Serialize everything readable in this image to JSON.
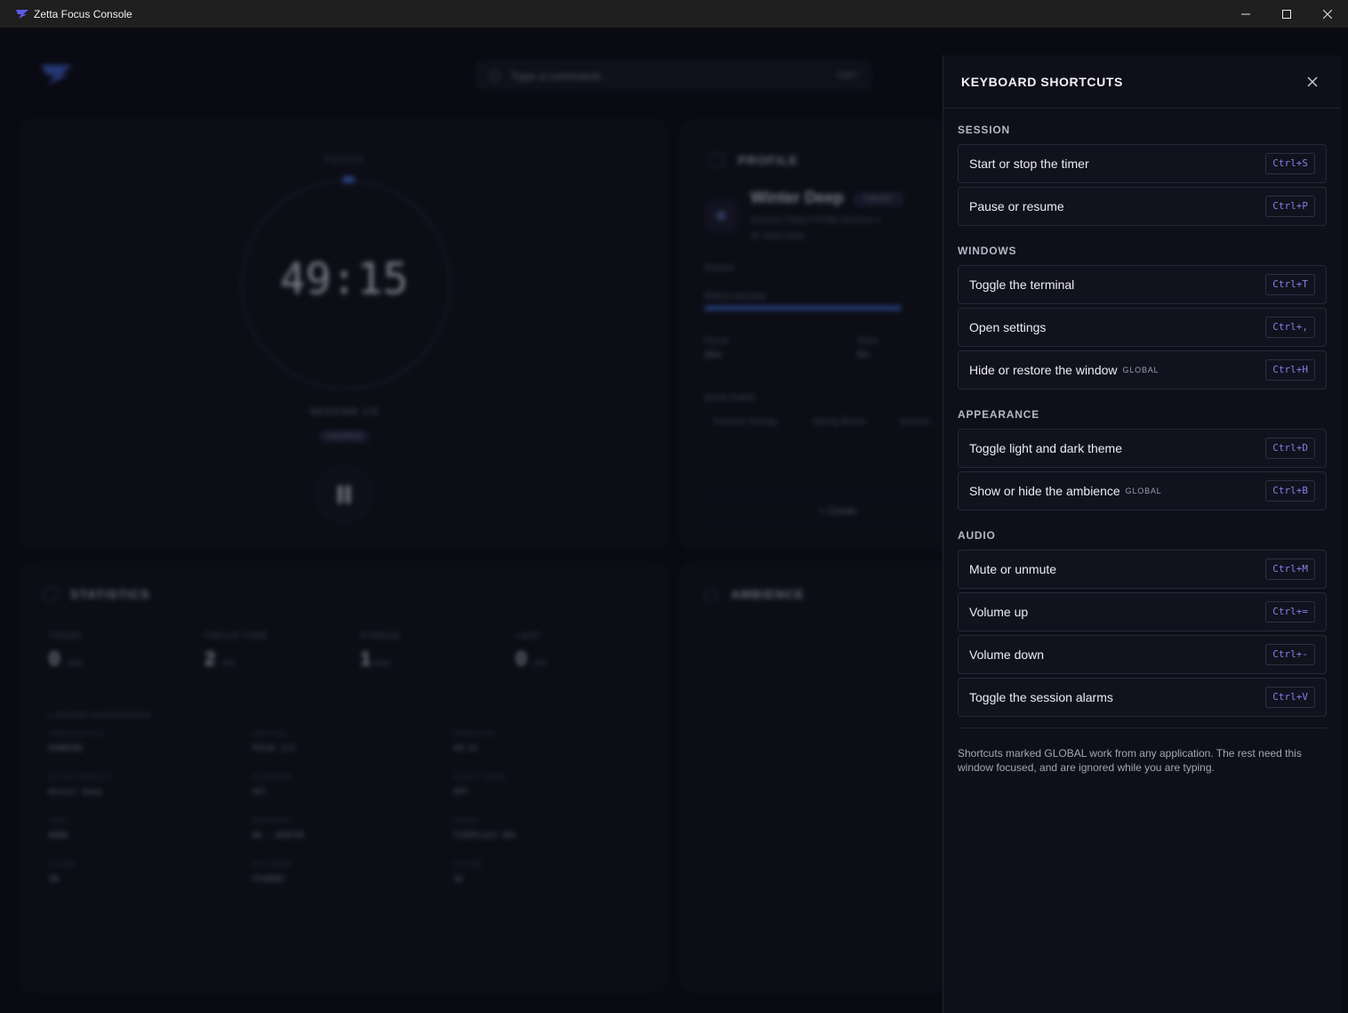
{
  "window": {
    "title": "Zetta Focus Console",
    "controls": {
      "minimize": "—",
      "maximize": "☐",
      "close": "✕"
    }
  },
  "background": {
    "command_placeholder": "Type a command...",
    "command_shortcut": "Ctrl  I",
    "timer": {
      "focus_label": "FOCUS",
      "time": "49:15",
      "session_label": "SESSION 1/3",
      "override_badge": "OVERRIDE"
    },
    "profile": {
      "title": "PROFILE",
      "name": "Winter Deep",
      "badge": "PRESET",
      "meta": "Sessions Today  0    Profile Sessions  4",
      "id": "ID: winter-deep",
      "season_label": "Season",
      "motion_label": "Motion Intensity",
      "focus_label": "Focus",
      "focus_value": "25m",
      "short_label": "Short",
      "short_value": "5m",
      "quick_switch_label": "Quick Switch",
      "chips": [
        "Summer Energy",
        "Spring Bloom",
        "Autumn"
      ],
      "create_label": "+  Create"
    },
    "statistics": {
      "title": "STATISTICS",
      "stats": [
        {
          "label": "TODAY",
          "value": "0",
          "unit": "sess"
        },
        {
          "label": "FOCUS TIME",
          "value": "2",
          "unit": "min"
        },
        {
          "label": "STREAK",
          "value": "1",
          "unit": "days"
        },
        {
          "label": "LAST",
          "value": "0",
          "unit": "min"
        }
      ],
      "diagnostics_title": "▸ ENGINE DIAGNOSTICS",
      "diagnostics": [
        {
          "label": "TIMER STATUS",
          "value": "RUNNING"
        },
        {
          "label": "SESSION",
          "value": "FOCUS 1/3"
        },
        {
          "label": "REMAINING",
          "value": "49:15"
        },
        {
          "label": "ACTIVE PROFILE",
          "value": "Winter Deep"
        },
        {
          "label": "OVERRIDE",
          "value": "SET"
        },
        {
          "label": "STRICT MODE",
          "value": "OFF"
        },
        {
          "label": "TASK",
          "value": "NONE"
        },
        {
          "label": "AMBIENCE",
          "value": "ON · WINTER"
        },
        {
          "label": "SOUND",
          "value": "FIREPLACE 50%"
        },
        {
          "label": "ALARM",
          "value": "ON"
        },
        {
          "label": "DEV MODE",
          "value": "STANDBY"
        },
        {
          "label": "UPTIME",
          "value": "3m"
        }
      ]
    },
    "ambience": {
      "title": "AMBIENCE"
    }
  },
  "shortcuts": {
    "title": "KEYBOARD SHORTCUTS",
    "close_icon": "✕",
    "global_tag": "GLOBAL",
    "sections": [
      {
        "title": "SESSION",
        "items": [
          {
            "label": "Start or stop the timer",
            "keys": "Ctrl+S",
            "global": false
          },
          {
            "label": "Pause or resume",
            "keys": "Ctrl+P",
            "global": false
          }
        ]
      },
      {
        "title": "WINDOWS",
        "items": [
          {
            "label": "Toggle the terminal",
            "keys": "Ctrl+T",
            "global": false
          },
          {
            "label": "Open settings",
            "keys": "Ctrl+,",
            "global": false
          },
          {
            "label": "Hide or restore the window",
            "keys": "Ctrl+H",
            "global": true
          }
        ]
      },
      {
        "title": "APPEARANCE",
        "items": [
          {
            "label": "Toggle light and dark theme",
            "keys": "Ctrl+D",
            "global": false
          },
          {
            "label": "Show or hide the ambience",
            "keys": "Ctrl+B",
            "global": true
          }
        ]
      },
      {
        "title": "AUDIO",
        "items": [
          {
            "label": "Mute or unmute",
            "keys": "Ctrl+M",
            "global": false
          },
          {
            "label": "Volume up",
            "keys": "Ctrl+=",
            "global": false
          },
          {
            "label": "Volume down",
            "keys": "Ctrl+-",
            "global": false
          },
          {
            "label": "Toggle the session alarms",
            "keys": "Ctrl+V",
            "global": false
          }
        ]
      }
    ],
    "footer": "Shortcuts marked GLOBAL work from any application. The rest need this window focused, and are ignored while you are typing."
  },
  "colors": {
    "accent": "#8c7ce8",
    "timer_ring_dot": "#3c6fd8",
    "panel_bg": "#0f0f1a"
  }
}
